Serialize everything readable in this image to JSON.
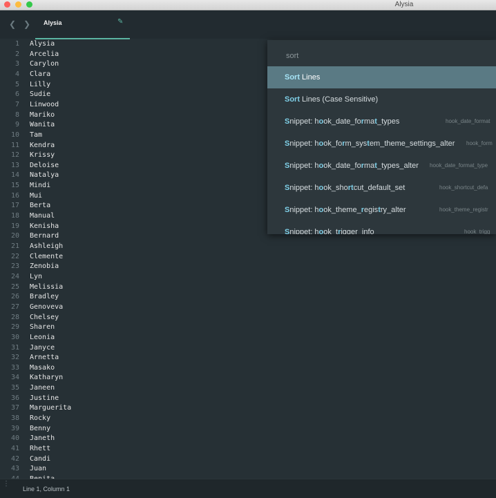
{
  "window": {
    "title": "Alysia"
  },
  "tab": {
    "label": "Alysia"
  },
  "editor": {
    "lines": [
      "Alysia",
      "Arcelia",
      "Carylon",
      "Clara",
      "Lilly",
      "Sudie",
      "Linwood",
      "Mariko",
      "Wanita",
      "Tam",
      "Kendra",
      "Krissy",
      "Deloise",
      "Natalya",
      "Mindi",
      "Mui",
      "Berta",
      "Manual",
      "Kenisha",
      "Bernard",
      "Ashleigh",
      "Clemente",
      "Zenobia",
      "Lyn",
      "Melissia",
      "Bradley",
      "Genoveva",
      "Chelsey",
      "Sharen",
      "Leonia",
      "Janyce",
      "Arnetta",
      "Masako",
      "Katharyn",
      "Janeen",
      "Justine",
      "Marguerita",
      "Rocky",
      "Benny",
      "Janeth",
      "Rhett",
      "Candi",
      "Juan",
      "Benita"
    ]
  },
  "palette": {
    "query": "sort",
    "results": [
      {
        "text": "Sort Lines",
        "hint": "",
        "selected": true
      },
      {
        "text": "Sort Lines (Case Sensitive)",
        "hint": "",
        "selected": false
      },
      {
        "text": "Snippet: hook_date_format_types",
        "hint": "hook_date_format",
        "selected": false
      },
      {
        "text": "Snippet: hook_form_system_theme_settings_alter",
        "hint": "hook_form",
        "selected": false
      },
      {
        "text": "Snippet: hook_date_format_types_alter",
        "hint": "hook_date_format_type",
        "selected": false
      },
      {
        "text": "Snippet: hook_shortcut_default_set",
        "hint": "hook_shortcut_defa",
        "selected": false
      },
      {
        "text": "Snippet: hook_theme_registry_alter",
        "hint": "hook_theme_registr",
        "selected": false
      },
      {
        "text": "Snippet: hook_trigger_info",
        "hint": "hook_trigg",
        "selected": false
      }
    ]
  },
  "status": {
    "text": "Line 1, Column 1"
  }
}
